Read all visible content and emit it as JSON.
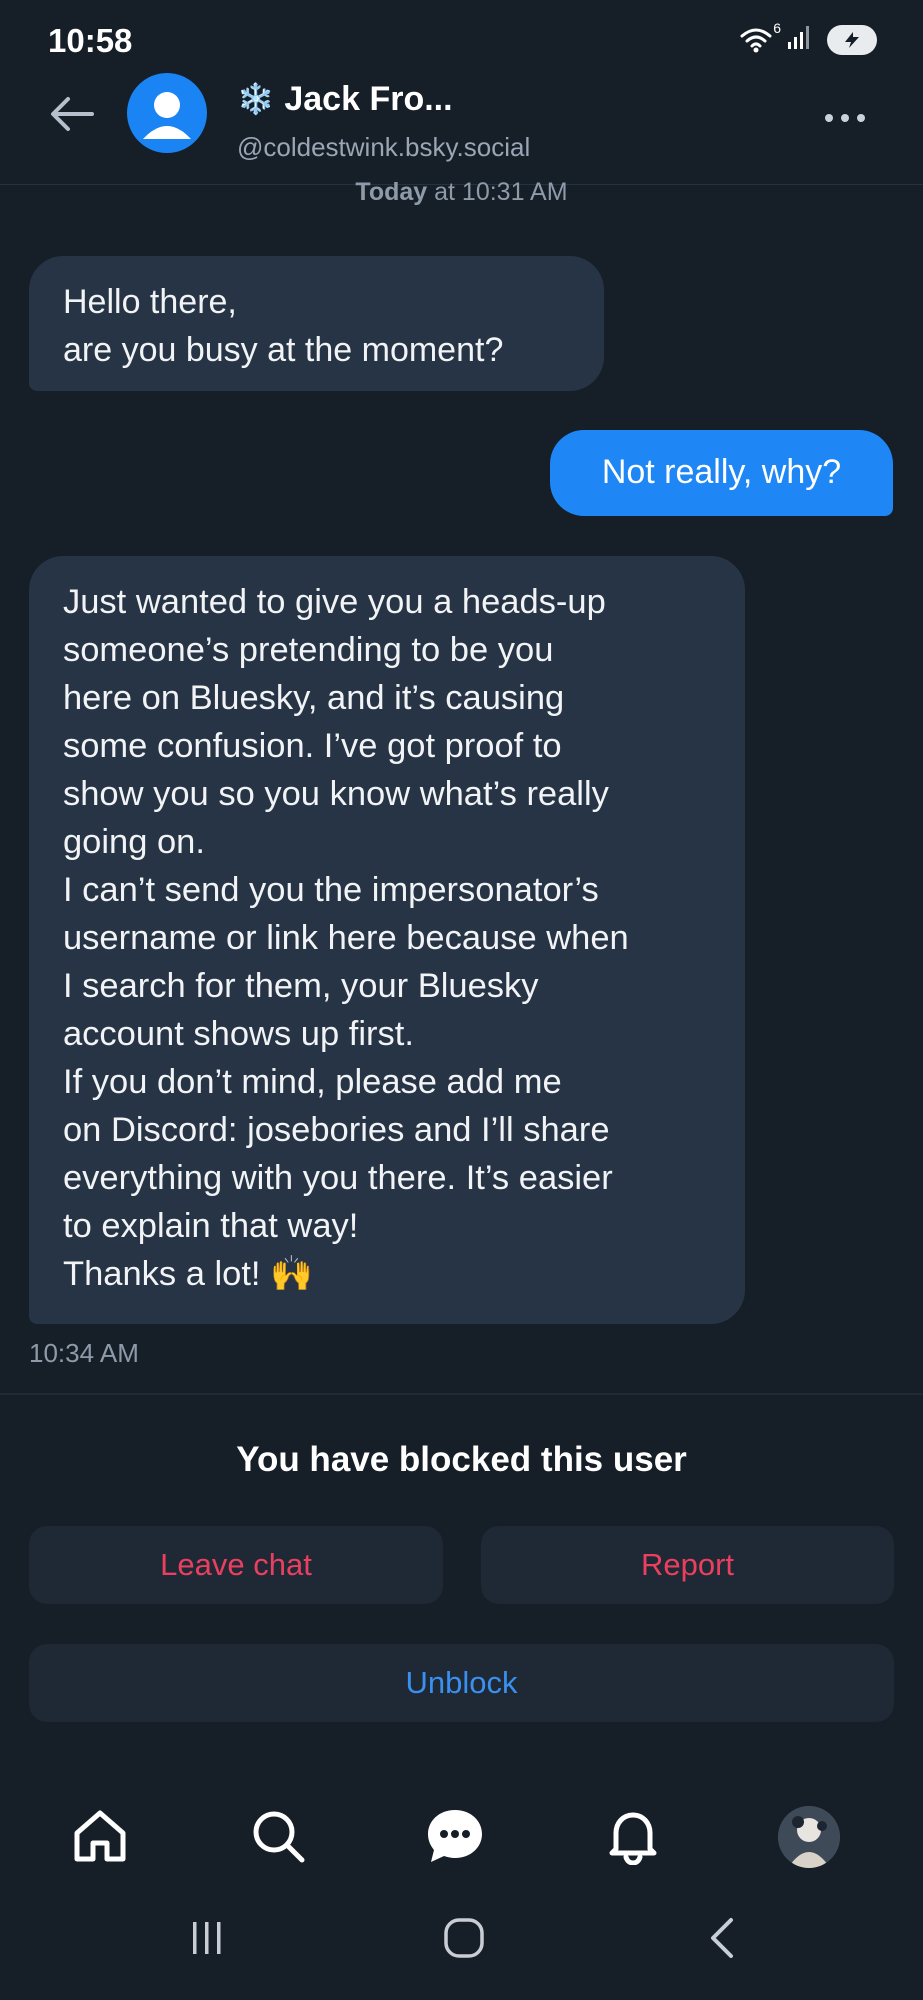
{
  "status_bar": {
    "time": "10:58",
    "wifi_label": "6",
    "icons": [
      "wifi-icon",
      "signal-icon",
      "battery-icon"
    ]
  },
  "header": {
    "title_emoji": "❄️",
    "title": "Jack Fro...",
    "handle": "@coldestwink.bsky.social",
    "icons": [
      "back-arrow-icon",
      "avatar",
      "more-icon"
    ]
  },
  "chat": {
    "date_day": "Today",
    "date_rest": " at 10:31 AM",
    "messages": [
      {
        "direction": "incoming",
        "text": "Hello there,\nare you busy at the moment?"
      },
      {
        "direction": "outgoing",
        "text": "Not really, why?"
      },
      {
        "direction": "incoming",
        "text": "Just wanted to give you a heads-up\nsomeone’s pretending to be you\nhere on Bluesky, and it’s causing\nsome confusion. I’ve got proof to\nshow you so you know what’s really\ngoing on.\nI can’t send you the impersonator’s\nusername or link here because when\nI search for them, your Bluesky\naccount shows up first.\nIf you don’t mind, please add me\non Discord: josebories and I’ll share\neverything with you there. It’s easier\nto explain that way!\nThanks a lot! 🙌"
      }
    ],
    "last_time": "10:34 AM"
  },
  "blocked": {
    "notice": "You have blocked this user",
    "leave_label": "Leave chat",
    "report_label": "Report",
    "unblock_label": "Unblock"
  },
  "bottom_nav": {
    "items": [
      "home-icon",
      "search-icon",
      "chat-icon",
      "bell-icon",
      "profile-avatar"
    ]
  },
  "system_nav": {
    "items": [
      "recents-icon",
      "home-circle-icon",
      "back-chevron-icon"
    ]
  },
  "colors": {
    "background": "#161e27",
    "incoming_bubble": "#263445",
    "outgoing_bubble": "#1e86f5",
    "danger": "#ea3f5f",
    "accent": "#3a8fef"
  }
}
